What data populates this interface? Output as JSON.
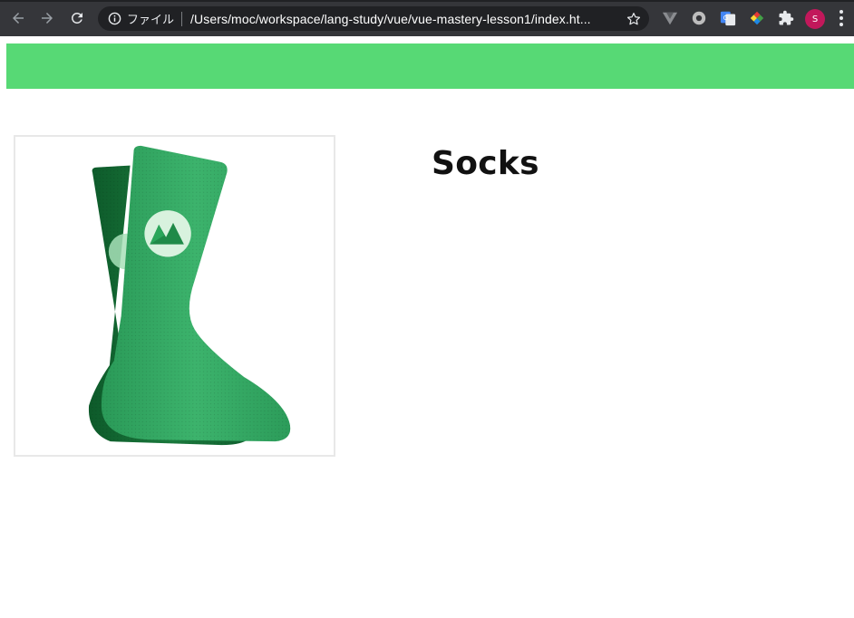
{
  "browser": {
    "scheme_label": "ファイル",
    "url": "/Users/moc/workspace/lang-study/vue/vue-mastery-lesson1/index.ht...",
    "profile_initial": "S",
    "icons": {
      "back": "arrow-left-icon",
      "forward": "arrow-right-icon",
      "reload": "reload-icon",
      "info": "info-icon",
      "bookmark": "star-icon",
      "extensions": [
        "vue-devtools-icon",
        "extension-circle-icon",
        "google-translate-icon",
        "color-picker-icon",
        "puzzle-icon"
      ]
    }
  },
  "colors": {
    "nav_bar": "#57d975",
    "avatar": "#c2185b",
    "toolbar": "#35363a"
  },
  "product": {
    "title": "Socks",
    "image_alt": "Green socks with Vue Mastery logo"
  }
}
